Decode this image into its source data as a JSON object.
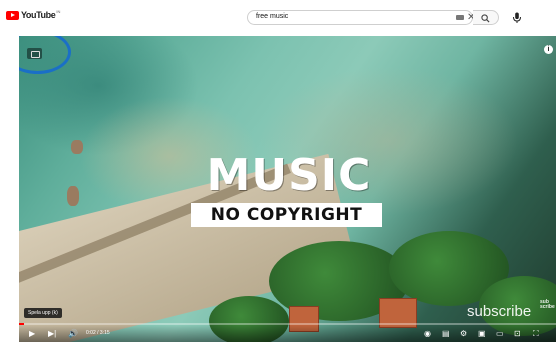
{
  "header": {
    "logo_text": "YouTube",
    "country_code": "IN",
    "search_value": "free music"
  },
  "video": {
    "title_main": "MUSIC",
    "title_sub": "NO COPYRIGHT",
    "watermark": "subscribe",
    "watermark_mini": "sub\nscribe",
    "tooltip": "Spela upp (k)",
    "time": "0:02 / 3:15",
    "progress": 0.01
  },
  "colors": {
    "brand": "#ff0000",
    "annotation": "#1a6fc7"
  },
  "icons": [
    "youtube-logo-icon",
    "keyboard-icon",
    "clear-icon",
    "search-icon",
    "mic-icon",
    "camera-icon",
    "info-icon",
    "play-icon",
    "next-icon",
    "volume-icon",
    "autoplay-icon",
    "subtitles-icon",
    "settings-icon",
    "miniplayer-icon",
    "theater-icon",
    "cast-icon",
    "fullscreen-icon"
  ]
}
